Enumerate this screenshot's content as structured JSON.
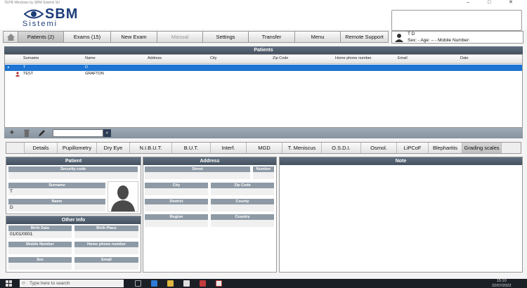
{
  "window": {
    "title": "TEPB Windows by SBM Sistemi Srl",
    "controls": [
      "–",
      "□",
      "✕"
    ]
  },
  "logo": {
    "brand": "SBM",
    "sub": "Sistemi"
  },
  "nav": {
    "home_icon": "home-icon",
    "tabs": [
      "Patients (2)",
      "Exams (15)",
      "New Exam",
      "Manual",
      "Settings",
      "Transfer",
      "Menu",
      "Remote Support"
    ]
  },
  "user": {
    "name": "T D",
    "details": "Sex: - Age: – - Mobile Number:"
  },
  "patients": {
    "title": "Patients",
    "columns": [
      "Surname",
      "Name",
      "Address",
      "City",
      "Zip Code",
      "Home phone number",
      "Email",
      "Date"
    ],
    "rows": [
      {
        "surname": "T",
        "name": "D"
      },
      {
        "surname": "TEST",
        "name": "GRAFTON"
      }
    ],
    "search_placeholder": ""
  },
  "exam_tabs": [
    "Details",
    "Pupillometry",
    "Dry Eye",
    "N.I.B.U.T.",
    "B.U.T.",
    "Interf.",
    "MGD",
    "T. Meniscus",
    "O.S.D.I.",
    "Osmol.",
    "LiPCoF",
    "Blepharitis",
    "Grading scales"
  ],
  "patient_panel": {
    "title": "Patient",
    "security_code_label": "Security code",
    "surname_label": "Surname",
    "surname": "T",
    "name_label": "Name",
    "name": "D"
  },
  "other_info": {
    "title": "Other Info",
    "birth_date_label": "Birth Date",
    "birth_date": "01/01/0001",
    "birth_place_label": "Birth Place",
    "mobile_label": "Mobile Number",
    "home_phone_label": "Home phone number",
    "sex_label": "Sex",
    "email_label": "Email"
  },
  "address_panel": {
    "title": "Address",
    "street_label": "Street",
    "number_label": "Number",
    "city_label": "City",
    "zip_label": "Zip Code",
    "district_label": "District",
    "county_label": "County",
    "region_label": "Region",
    "country_label": "Country"
  },
  "note_panel": {
    "title": "Note"
  },
  "taskbar": {
    "search_text": "Type here to search",
    "time": "15:10",
    "date": "22/07/2022"
  },
  "colors": {
    "selection": "#1e74d2",
    "header_bar": "#4b5766",
    "label_bg": "#8e9aa6",
    "taskbar": "#1b1f26"
  }
}
